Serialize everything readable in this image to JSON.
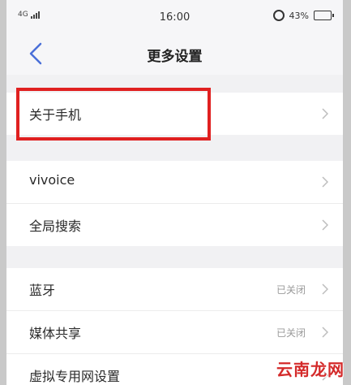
{
  "status_bar": {
    "network": "4G",
    "time": "16:00",
    "battery_percent": "43%"
  },
  "header": {
    "title": "更多设置",
    "back_icon": "chevron-left-icon"
  },
  "groups": [
    {
      "items": [
        {
          "label": "关于手机"
        }
      ]
    },
    {
      "items": [
        {
          "label": "vivoice"
        },
        {
          "label": "全局搜索"
        }
      ]
    },
    {
      "items": [
        {
          "label": "蓝牙",
          "value": "已关闭"
        },
        {
          "label": "媒体共享",
          "value": "已关闭"
        },
        {
          "label": "虚拟专用网设置"
        }
      ]
    }
  ],
  "highlight_color": "#e02020",
  "accent_color": "#4a6fd8",
  "watermark": "云南龙网"
}
